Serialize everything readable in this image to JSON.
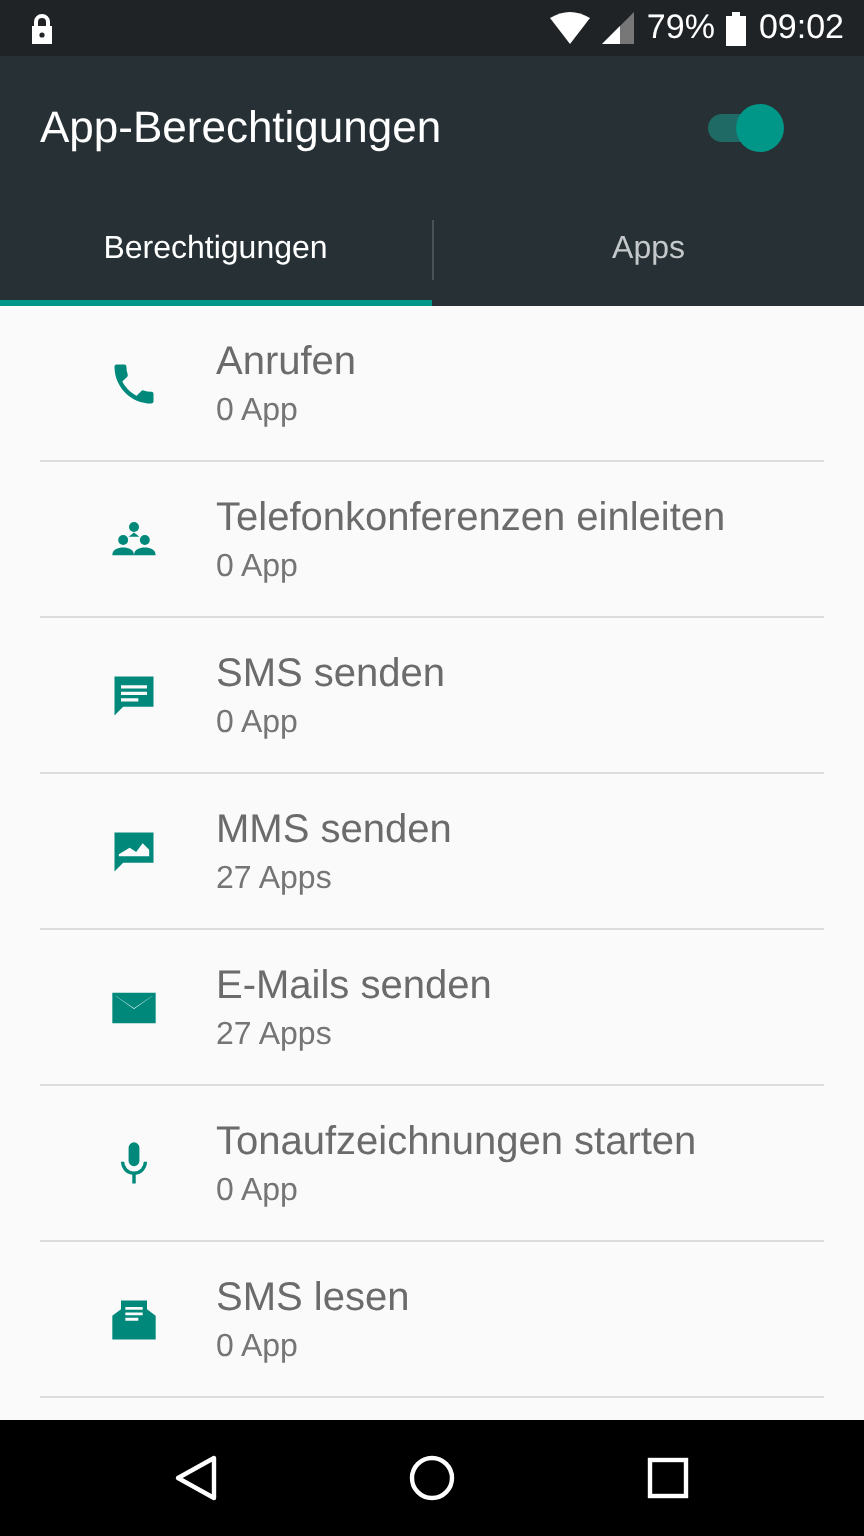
{
  "status_bar": {
    "battery": "79%",
    "time": "09:02"
  },
  "app_bar": {
    "title": "App-Berechtigungen",
    "toggle": {
      "on": true
    }
  },
  "tabs": [
    {
      "label": "Berechtigungen",
      "selected": true
    },
    {
      "label": "Apps",
      "selected": false
    }
  ],
  "permissions": [
    {
      "title": "Anrufen",
      "count": "0 App"
    },
    {
      "title": "Telefonkonferenzen einleiten",
      "count": "0 App"
    },
    {
      "title": "SMS senden",
      "count": "0 App"
    },
    {
      "title": "MMS senden",
      "count": "27 Apps"
    },
    {
      "title": "E-Mails senden",
      "count": "27 Apps"
    },
    {
      "title": "Tonaufzeichnungen starten",
      "count": "0 App"
    },
    {
      "title": "SMS lesen",
      "count": "0 App"
    }
  ]
}
